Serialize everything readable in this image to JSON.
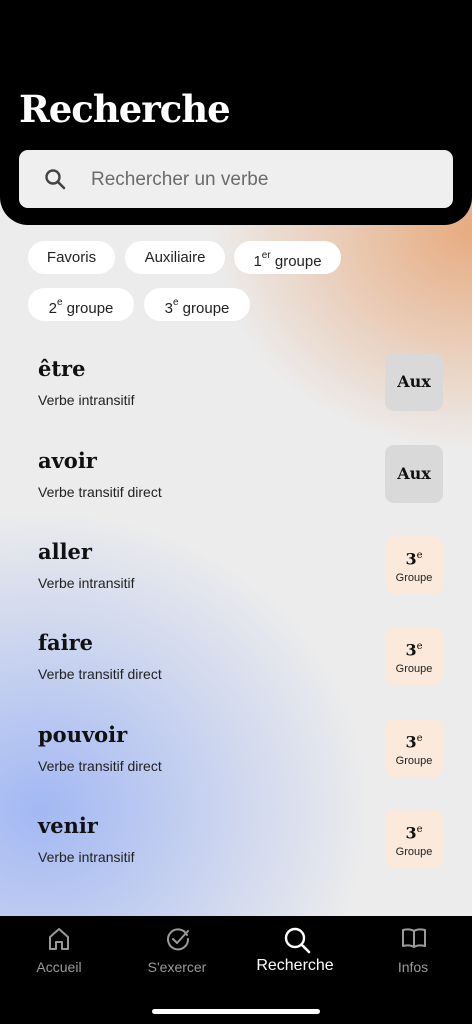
{
  "header": {
    "title": "Recherche",
    "search_placeholder": "Rechercher un verbe"
  },
  "filters": [
    {
      "label": "Favoris"
    },
    {
      "label": "Auxiliaire"
    },
    {
      "label_prefix": "1",
      "label_sup": "er",
      "label_suffix": " groupe"
    },
    {
      "label_prefix": "2",
      "label_sup": "e",
      "label_suffix": " groupe"
    },
    {
      "label_prefix": "3",
      "label_sup": "e",
      "label_suffix": " groupe"
    }
  ],
  "verbs": [
    {
      "name": "être",
      "type": "Verbe intransitif",
      "badge": "Aux"
    },
    {
      "name": "avoir",
      "type": "Verbe transitif direct",
      "badge": "Aux"
    },
    {
      "name": "aller",
      "type": "Verbe intransitif",
      "badge_num": "3",
      "badge_sup": "e",
      "badge_sub": "Groupe"
    },
    {
      "name": "faire",
      "type": "Verbe transitif direct",
      "badge_num": "3",
      "badge_sup": "e",
      "badge_sub": "Groupe"
    },
    {
      "name": "pouvoir",
      "type": "Verbe transitif direct",
      "badge_num": "3",
      "badge_sup": "e",
      "badge_sub": "Groupe"
    },
    {
      "name": "venir",
      "type": "Verbe intransitif",
      "badge_num": "3",
      "badge_sup": "e",
      "badge_sub": "Groupe"
    }
  ],
  "tabs": [
    {
      "label": "Accueil",
      "icon": "home-icon"
    },
    {
      "label": "S'exercer",
      "icon": "check-circle-icon"
    },
    {
      "label": "Recherche",
      "icon": "search-icon",
      "active": true
    },
    {
      "label": "Infos",
      "icon": "book-icon"
    }
  ],
  "colors": {
    "header_bg": "#000000",
    "aux_badge": "#d9d9d9",
    "group_badge": "#fbeadb",
    "accent_orange": "#e6a06e",
    "accent_blue": "#96aff5"
  }
}
